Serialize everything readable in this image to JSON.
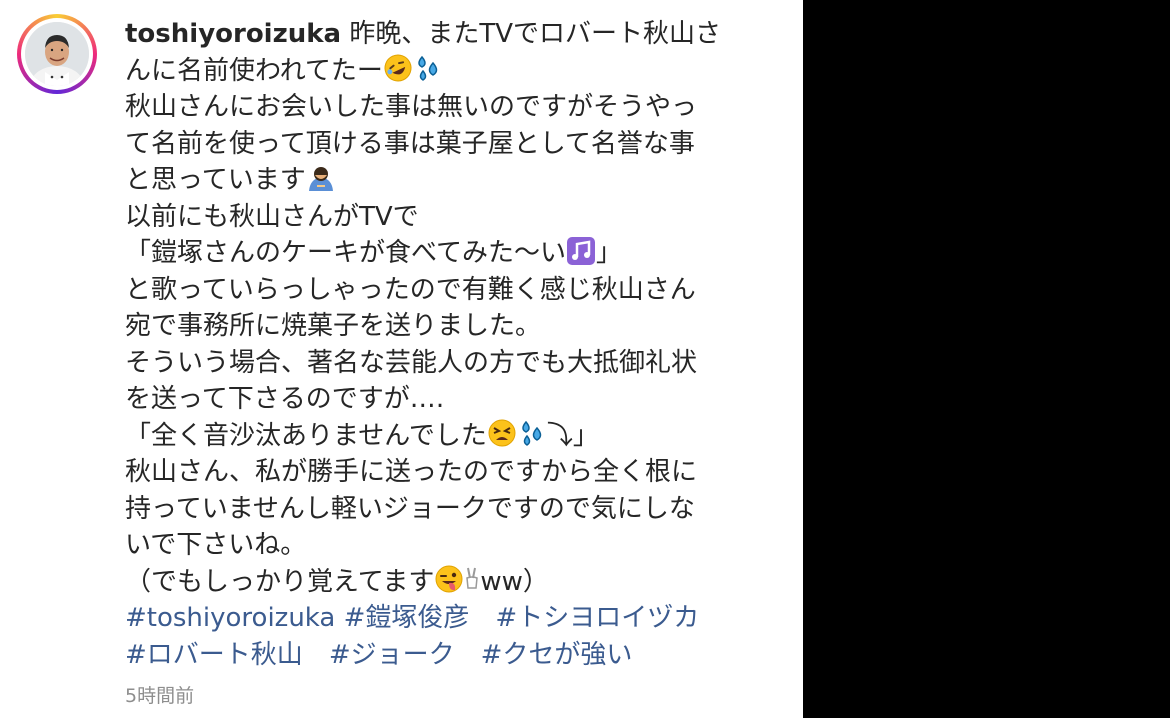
{
  "post": {
    "username": "toshiyoroizuka",
    "timestamp": "5時間前",
    "caption_lines": {
      "l1": "昨晩、またTVでロバート秋山さ",
      "l2": "んに名前使われてたー",
      "l3": "秋山さんにお会いした事は無いのですがそうやっ",
      "l4": "て名前を使って頂ける事は菓子屋として名誉な事",
      "l5": "と思っています",
      "l6": "以前にも秋山さんがTVで",
      "l7": "「鎧塚さんのケーキが食べてみた〜い",
      "l7b": "」",
      "l8": "と歌っていらっしゃったので有難く感じ秋山さん",
      "l9": "宛で事務所に焼菓子を送りました。",
      "l10": "そういう場合、著名な芸能人の方でも大抵御礼状",
      "l11": "を送って下さるのですが‥‥",
      "l12": "「全く音沙汰ありませんでした",
      "l12b": "⤵」",
      "l13": "秋山さん、私が勝手に送ったのですから全く根に",
      "l14": "持っていませんし軽いジョークですので気にしな",
      "l15": "いで下さいね。",
      "l16": "（でもしっかり覚えてます",
      "l16b": "ww）"
    },
    "hashtags": {
      "t1": "#toshiyoroizuka",
      "t2": "#鎧塚俊彦",
      "t3": "#トシヨロイヅカ",
      "t4": "#ロバート秋山",
      "t5": "#ジョーク",
      "t6": "#クセが強い"
    },
    "emojis": [
      "rofl-face",
      "sweat-droplets",
      "person-bowing",
      "musical-notes",
      "tired-face",
      "sweat-droplets",
      "winking-tongue-face",
      "victory-hand"
    ]
  },
  "colors": {
    "text": "#262626",
    "hashtag": "#3b5b8f",
    "timestamp": "#8e8e8e",
    "side_panel": "#000000"
  }
}
